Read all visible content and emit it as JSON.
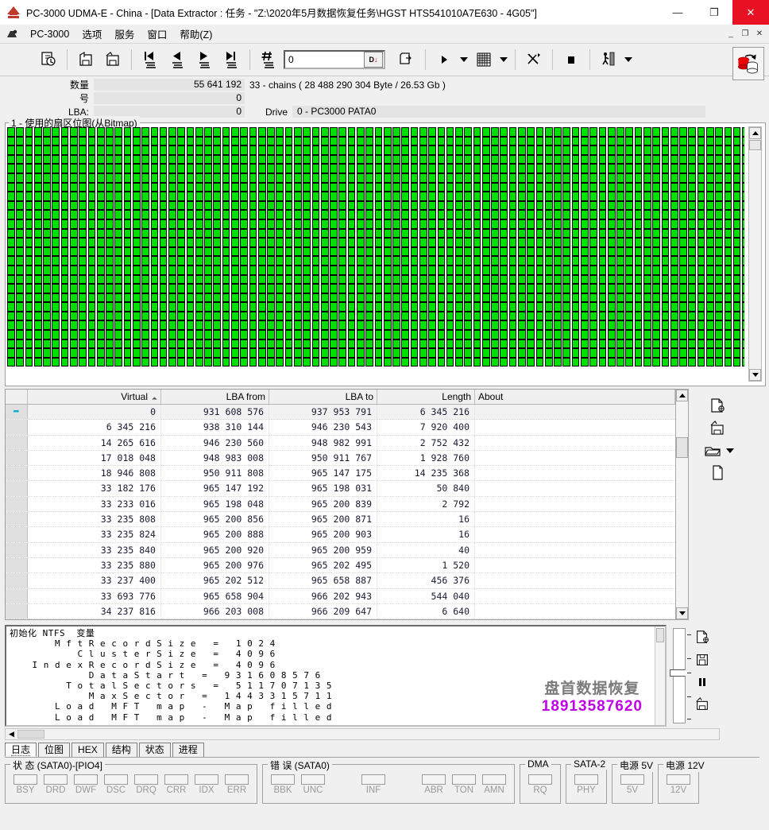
{
  "window": {
    "title": "PC-3000 UDMA-E - China - [Data Extractor : 任务 - \"Z:\\2020年5月数据恢复任务\\HGST HTS541010A7E630 - 4G05\"]",
    "minimize": "—",
    "maximize": "❐",
    "close": "✕",
    "mdi_minimize": "_",
    "mdi_restore": "❐",
    "mdi_close": "✕"
  },
  "menu": {
    "items": [
      {
        "label": "PC-3000"
      },
      {
        "label": "选项"
      },
      {
        "label": "服务"
      },
      {
        "label": "窗口"
      },
      {
        "label": "帮助(Z)"
      }
    ]
  },
  "toolbar": {
    "number_value": "0",
    "number_button": "D",
    "icons": [
      "refresh-task-icon",
      "save-task-icon",
      "save-as-task-icon",
      "first-record-icon",
      "prev-record-icon",
      "next-record-icon",
      "last-record-icon",
      "goto-record-icon",
      "new-page-icon",
      "run-icon",
      "grid-icon",
      "tools-icon",
      "stop-icon",
      "runner-icon"
    ],
    "copy_icon": "copy-drive-icon"
  },
  "info": {
    "count_label": "数量",
    "count_value": "55 641 192",
    "chains_text": "33 - chains  ( 28 488 290 304 Byte /  26.53 Gb )",
    "num_label": "号",
    "num_value": "0",
    "lba_label": "LBA:",
    "lba_value": "0",
    "drive_label": "Drive",
    "drive_value": "0 - PC3000 PATA0"
  },
  "bitmap": {
    "legend": "1 - 使用的扇区位图(从Bitmap)",
    "cell_color": "#00e000",
    "cell_border": "#000000",
    "columns": 86,
    "rows": 26
  },
  "table": {
    "headers": [
      "",
      "Virtual",
      "LBA from",
      "LBA to",
      "Length",
      "About"
    ],
    "sort_indicator": "⏶",
    "rows": [
      {
        "marker": "➦",
        "virtual": "0",
        "lba_from": "931 608 576",
        "lba_to": "937 953 791",
        "length": "6 345 216",
        "about": ""
      },
      {
        "marker": "",
        "virtual": "6 345 216",
        "lba_from": "938 310 144",
        "lba_to": "946 230 543",
        "length": "7 920 400",
        "about": ""
      },
      {
        "marker": "",
        "virtual": "14 265 616",
        "lba_from": "946 230 560",
        "lba_to": "948 982 991",
        "length": "2 752 432",
        "about": ""
      },
      {
        "marker": "",
        "virtual": "17 018 048",
        "lba_from": "948 983 008",
        "lba_to": "950 911 767",
        "length": "1 928 760",
        "about": ""
      },
      {
        "marker": "",
        "virtual": "18 946 808",
        "lba_from": "950 911 808",
        "lba_to": "965 147 175",
        "length": "14 235 368",
        "about": ""
      },
      {
        "marker": "",
        "virtual": "33 182 176",
        "lba_from": "965 147 192",
        "lba_to": "965 198 031",
        "length": "50 840",
        "about": ""
      },
      {
        "marker": "",
        "virtual": "33 233 016",
        "lba_from": "965 198 048",
        "lba_to": "965 200 839",
        "length": "2 792",
        "about": ""
      },
      {
        "marker": "",
        "virtual": "33 235 808",
        "lba_from": "965 200 856",
        "lba_to": "965 200 871",
        "length": "16",
        "about": ""
      },
      {
        "marker": "",
        "virtual": "33 235 824",
        "lba_from": "965 200 888",
        "lba_to": "965 200 903",
        "length": "16",
        "about": ""
      },
      {
        "marker": "",
        "virtual": "33 235 840",
        "lba_from": "965 200 920",
        "lba_to": "965 200 959",
        "length": "40",
        "about": ""
      },
      {
        "marker": "",
        "virtual": "33 235 880",
        "lba_from": "965 200 976",
        "lba_to": "965 202 495",
        "length": "1 520",
        "about": ""
      },
      {
        "marker": "",
        "virtual": "33 237 400",
        "lba_from": "965 202 512",
        "lba_to": "965 658 887",
        "length": "456 376",
        "about": ""
      },
      {
        "marker": "",
        "virtual": "33 693 776",
        "lba_from": "965 658 904",
        "lba_to": "966 202 943",
        "length": "544 040",
        "about": ""
      },
      {
        "marker": "",
        "virtual": "34 237 816",
        "lba_from": "966 203 008",
        "lba_to": "966 209 647",
        "length": "6 640",
        "about": ""
      }
    ],
    "side_icons": [
      "copy-record-icon",
      "save-record-icon",
      "open-folder-icon",
      "page-icon"
    ]
  },
  "log": {
    "text": "初始化 NTFS  变量\n        M f t R e c o r d S i z e   =   1 0 2 4\n            C l u s t e r S i z e   =   4 0 9 6\n    I n d e x R e c o r d S i z e   =   4 0 9 6\n              D a t a S t a r t   =   9 3 1 6 0 8 5 7 6\n          T o t a l S e c t o r s   =   5 1 1 7 0 7 1 3 5\n              M a x S e c t o r   =   1 4 4 3 3 1 5 7 1 1\n        L o a d   M F T   m a p   -   M a p   f i l l e d\n        L o a d   M F T   m a p   -   M a p   f i l l e d",
    "watermark_line1": "盘首数据恢复",
    "watermark_line2": "18913587620",
    "side_icons": [
      "copy-log-icon",
      "save-log-icon",
      "pause-icon",
      "save-as-log-icon"
    ]
  },
  "tabs": [
    {
      "label": "日志",
      "active": true
    },
    {
      "label": "位图",
      "active": false
    },
    {
      "label": "HEX",
      "active": false
    },
    {
      "label": "结构",
      "active": false
    },
    {
      "label": "状态",
      "active": false
    },
    {
      "label": "进程",
      "active": false
    }
  ],
  "status_panels": [
    {
      "legend": "状 态 (SATA0)-[PIO4]",
      "leds": [
        {
          "cap": "BSY",
          "blank": false
        },
        {
          "cap": "DRD",
          "blank": false
        },
        {
          "cap": "DWF",
          "blank": false
        },
        {
          "cap": "DSC",
          "blank": false
        },
        {
          "cap": "DRQ",
          "blank": false
        },
        {
          "cap": "CRR",
          "blank": false
        },
        {
          "cap": "IDX",
          "blank": false
        },
        {
          "cap": "ERR",
          "blank": false
        }
      ]
    },
    {
      "legend": "错 误 (SATA0)",
      "leds": [
        {
          "cap": "BBK",
          "blank": false
        },
        {
          "cap": "UNC",
          "blank": false
        },
        {
          "cap": "",
          "blank": true
        },
        {
          "cap": "INF",
          "blank": false
        },
        {
          "cap": "",
          "blank": true
        },
        {
          "cap": "ABR",
          "blank": false
        },
        {
          "cap": "TON",
          "blank": false
        },
        {
          "cap": "AMN",
          "blank": false
        }
      ]
    },
    {
      "legend": "DMA",
      "leds": [
        {
          "cap": "RQ",
          "blank": false
        }
      ]
    },
    {
      "legend": "SATA-2",
      "leds": [
        {
          "cap": "PHY",
          "blank": false
        }
      ]
    },
    {
      "legend": "电源 5V",
      "leds": [
        {
          "cap": "5V",
          "blank": false
        }
      ]
    },
    {
      "legend": "电源 12V",
      "leds": [
        {
          "cap": "12V",
          "blank": false
        }
      ]
    }
  ],
  "colors": {
    "accent_red": "#e81123",
    "bitmap_green": "#00e000",
    "watermark_purple": "#c000e8",
    "marker_cyan": "#00b0d0"
  }
}
